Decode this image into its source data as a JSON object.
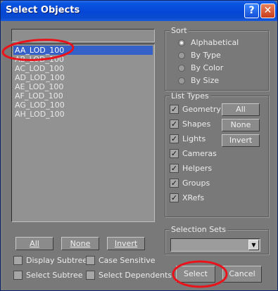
{
  "window": {
    "title": "Select Objects",
    "help_glyph": "?",
    "close_glyph": "✕"
  },
  "search": {
    "value": ""
  },
  "objects": {
    "items": [
      "AA_LOD_100",
      "AB_LOD_100",
      "AC_LOD_100",
      "AD_LOD_100",
      "AE_LOD_100",
      "AF_LOD_100",
      "AG_LOD_100",
      "AH_LOD_100"
    ],
    "selected": "AA_LOD_100"
  },
  "sort": {
    "label": "Sort",
    "options": [
      "Alphabetical",
      "By Type",
      "By Color",
      "By Size"
    ],
    "selected": "Alphabetical"
  },
  "list_types": {
    "label": "List Types",
    "types": [
      "Geometry",
      "Shapes",
      "Lights",
      "Cameras",
      "Helpers",
      "Groups",
      "XRefs"
    ],
    "checked": [
      true,
      true,
      true,
      true,
      true,
      true,
      true
    ],
    "buttons": {
      "all": "All",
      "none": "None",
      "invert": "Invert"
    }
  },
  "selection_sets": {
    "label": "Selection Sets",
    "value": ""
  },
  "list_buttons": {
    "all": "All",
    "none": "None",
    "invert": "Invert"
  },
  "options": {
    "display_subtree": "Display Subtree",
    "case_sensitive": "Case Sensitive",
    "select_subtree": "Select Subtree",
    "select_dependents": "Select Dependents"
  },
  "actions": {
    "select": "Select",
    "cancel": "Cancel"
  },
  "colors": {
    "title_bar": "#0546d6",
    "selection": "#3560c8",
    "annotation": "#e8131b"
  }
}
